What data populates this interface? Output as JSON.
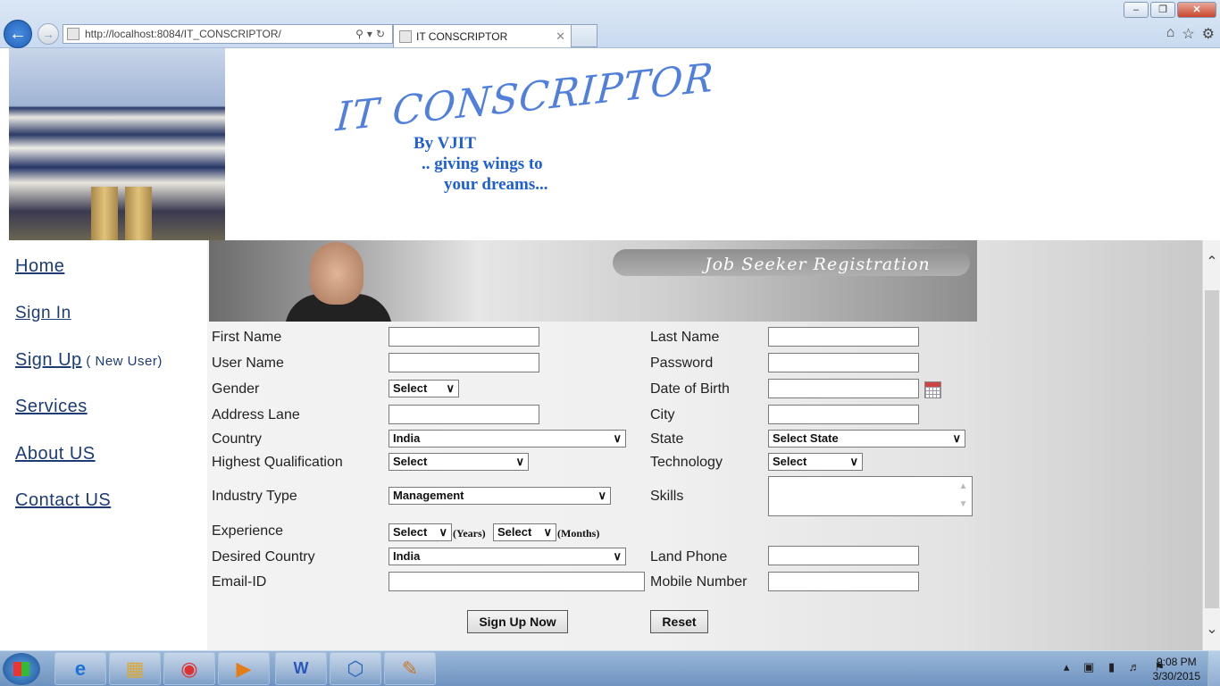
{
  "browser": {
    "url": "http://localhost:8084/IT_CONSCRIPTOR/",
    "tab_title": "IT CONSCRIPTOR"
  },
  "header": {
    "logo_text": "IT CONSCRIPTOR",
    "tagline_by": "By VJIT",
    "tagline_1": ".. giving wings to",
    "tagline_2": "your dreams..."
  },
  "nav": {
    "home": "Home",
    "sign_in": "Sign In",
    "sign_up": "Sign Up",
    "sign_up_note": " ( New User)",
    "services": "Services",
    "about": "About US",
    "contact": "Contact US"
  },
  "banner": {
    "title": "Job Seeker Registration"
  },
  "form": {
    "first_name": "First Name",
    "last_name": "Last Name",
    "user_name": "User Name",
    "password": "Password",
    "gender": "Gender",
    "gender_value": "Select",
    "dob": "Date of Birth",
    "address": "Address Lane",
    "city": "City",
    "country": "Country",
    "country_value": "India",
    "state": "State",
    "state_value": "Select State",
    "qualification": "Highest Qualification",
    "qualification_value": "Select",
    "technology": "Technology",
    "technology_value": "Select",
    "industry": "Industry Type",
    "industry_value": "Management",
    "skills": "Skills",
    "experience": "Experience",
    "exp_years_value": "Select",
    "exp_years_unit": "(Years)",
    "exp_months_value": "Select",
    "exp_months_unit": "(Months)",
    "desired_country": "Desired Country",
    "desired_country_value": "India",
    "land_phone": "Land Phone",
    "email": "Email-ID",
    "mobile": "Mobile Number",
    "submit": "Sign Up Now",
    "reset": "Reset"
  },
  "taskbar": {
    "time": "9:08 PM",
    "date": "3/30/2015"
  }
}
